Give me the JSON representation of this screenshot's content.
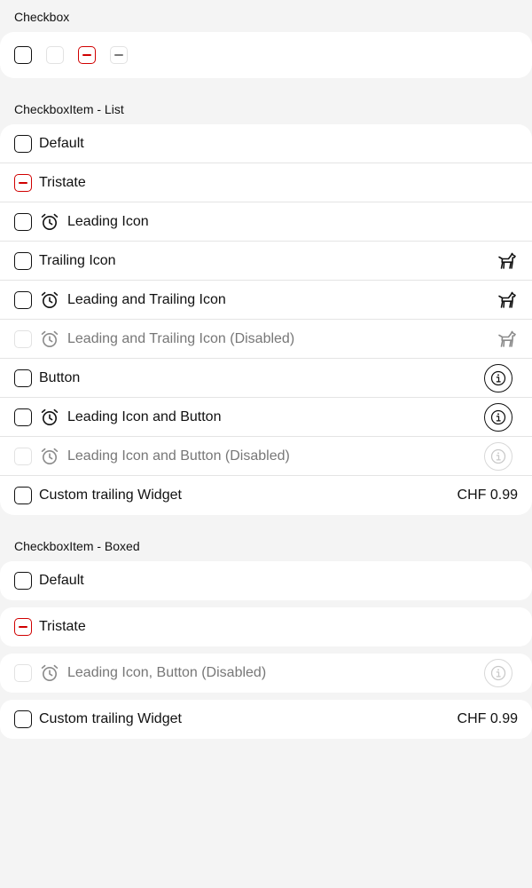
{
  "sections": {
    "checkbox": {
      "title": "Checkbox"
    },
    "list": {
      "title": "CheckboxItem - List",
      "items": [
        {
          "label": "Default"
        },
        {
          "label": "Tristate"
        },
        {
          "label": "Leading Icon"
        },
        {
          "label": "Trailing Icon"
        },
        {
          "label": "Leading and Trailing Icon"
        },
        {
          "label": "Leading and Trailing Icon (Disabled)"
        },
        {
          "label": "Button"
        },
        {
          "label": "Leading Icon and Button"
        },
        {
          "label": "Leading Icon and Button (Disabled)"
        },
        {
          "label": "Custom trailing Widget",
          "trailing_text": "CHF 0.99"
        }
      ]
    },
    "boxed": {
      "title": "CheckboxItem - Boxed",
      "items": [
        {
          "label": "Default"
        },
        {
          "label": "Tristate"
        },
        {
          "label": "Leading Icon, Button (Disabled)"
        },
        {
          "label": "Custom trailing Widget",
          "trailing_text": "CHF 0.99"
        }
      ]
    }
  },
  "icons": {
    "leading": "alarm-clock-icon",
    "trailing": "dog-icon",
    "button": "info-icon"
  },
  "colors": {
    "background": "#f4f4f4",
    "surface": "#ffffff",
    "accent": "#d00000",
    "text": "#111111",
    "disabled_text": "#777777"
  }
}
